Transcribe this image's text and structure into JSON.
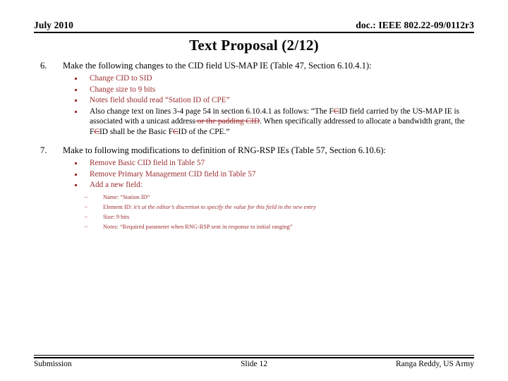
{
  "header": {
    "date": "July 2010",
    "doc": "doc.: IEEE 802.22-09/0112r3"
  },
  "title": "Text Proposal (2/12)",
  "items": [
    {
      "number": "6.",
      "text": "Make the following changes to the CID field US-MAP IE (Table 47, Section 6.10.4.1):",
      "bullets": [
        {
          "text": "Change CID to SID"
        },
        {
          "text": "Change size to 9 bits"
        },
        {
          "text": "Notes field should read “Station ID of CPE”"
        }
      ],
      "paragraph": {
        "p1": "Also change text on lines 3-4 page 54 in section 6.10.4.1 as follows: “The F",
        "strike_c1": "C",
        "p2": "ID field carried by the US-MAP IE is associated with a unicast address",
        "strike_phrase": " or the padding CID",
        "p3": ". When specifically addressed to allocate a bandwidth grant, the F",
        "strike_c2": "C",
        "p4": "ID shall be the Basic F",
        "strike_c3": "C",
        "p5": "ID of the CPE.”"
      }
    },
    {
      "number": "7.",
      "text": "Make to following modifications to definition of RNG-RSP IEs (Table 57, Section 6.10.6):",
      "bullets": [
        {
          "text": "Remove Basic CID field in Table 57"
        },
        {
          "text": "Remove Primary Management CID field in Table 57"
        },
        {
          "text": "Add a new field:"
        }
      ],
      "subfields": [
        {
          "label": "Name: “Station ID”",
          "italic": ""
        },
        {
          "label": "Element ID: ",
          "italic": "it’s at the editor’s discretion to specify the value for this field in the new entry"
        },
        {
          "label": "Size: 9 bits",
          "italic": ""
        },
        {
          "label": "Notes: “Required parameter when RNG-RSP sent in response to initial ranging”",
          "italic": ""
        }
      ]
    }
  ],
  "footer": {
    "left": "Submission",
    "center": "Slide 12",
    "right": "Ranga Reddy, US Army"
  },
  "colors": {
    "accent_red": "#9b2d30",
    "text_black": "#000000",
    "background": "#ffffff"
  }
}
